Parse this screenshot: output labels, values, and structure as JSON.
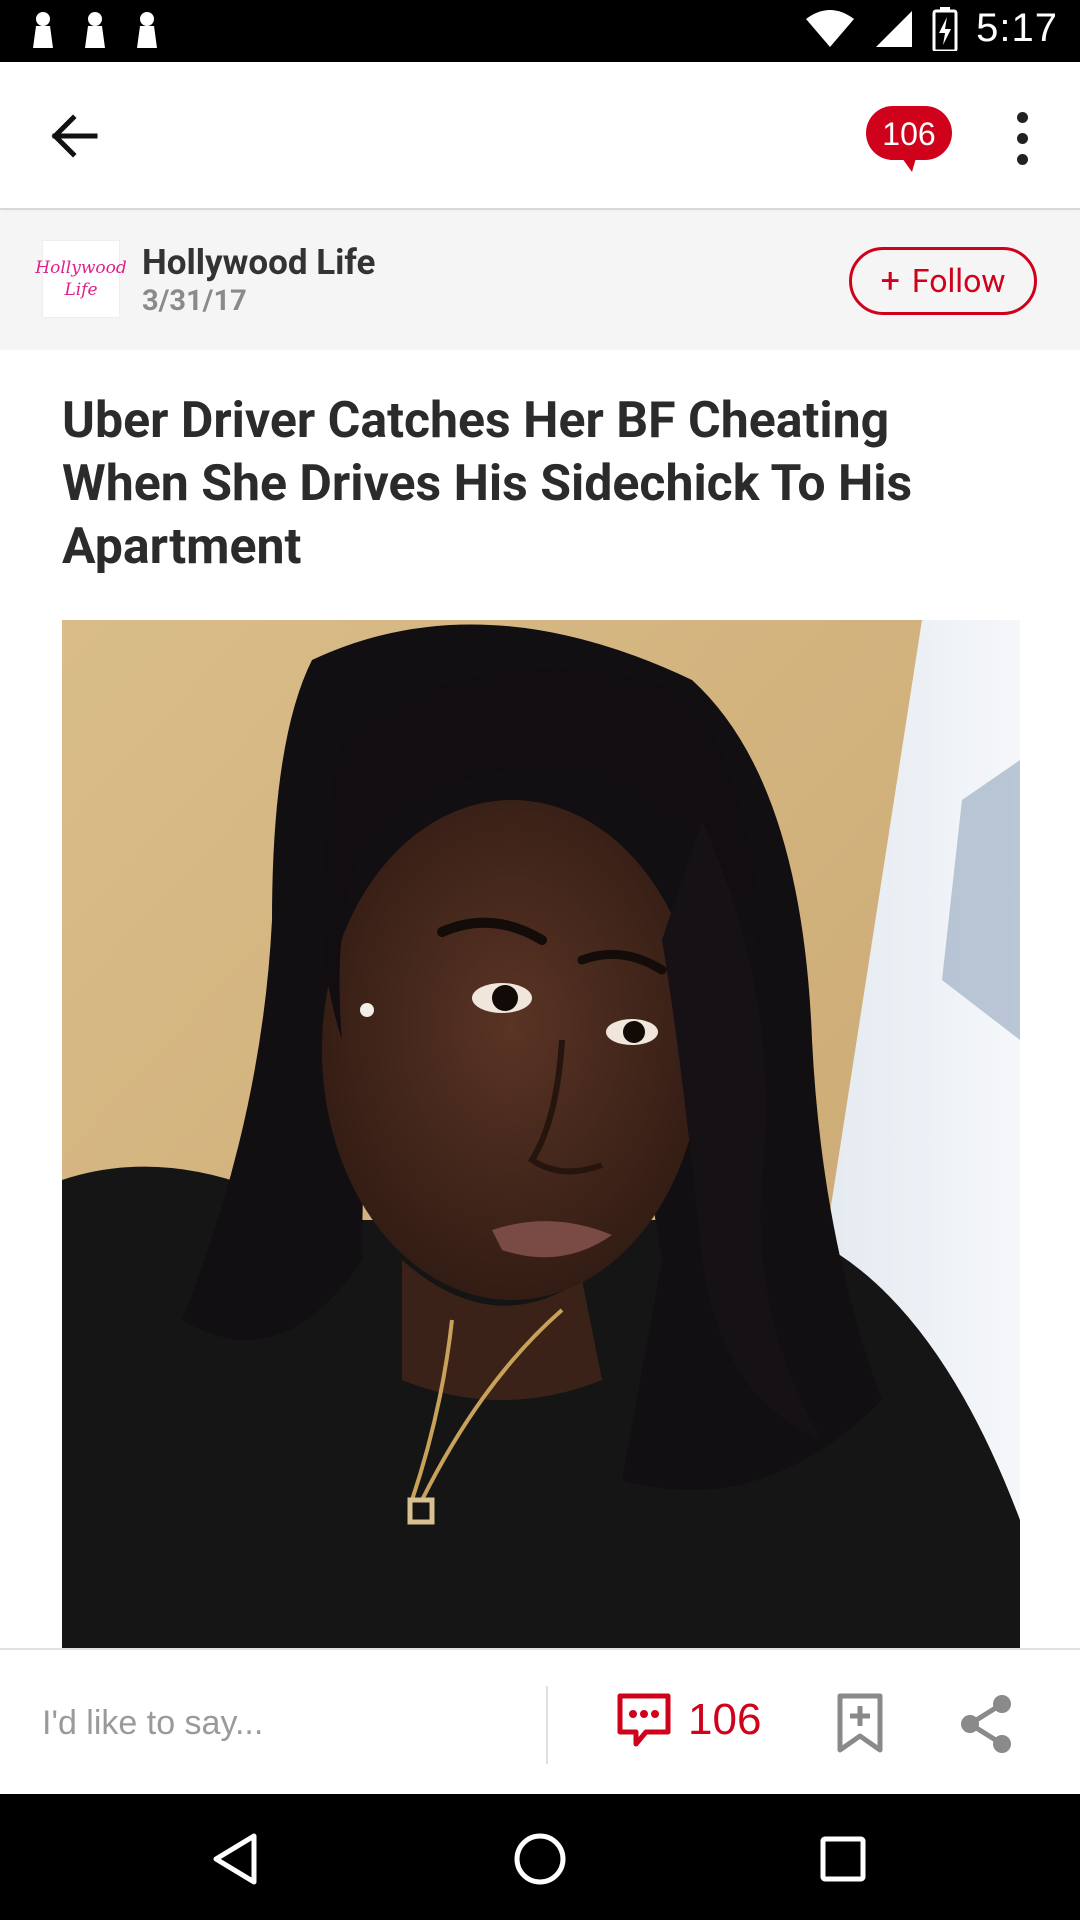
{
  "status_bar": {
    "time": "5:17",
    "icons": [
      "notification-icon",
      "notification-icon",
      "notification-icon",
      "wifi-icon",
      "cell-signal-icon",
      "battery-charging-icon"
    ]
  },
  "app_bar": {
    "back_icon": "arrow-left-icon",
    "comment_count": "106",
    "menu_icon": "more-vert-icon"
  },
  "publisher": {
    "logo_lines": [
      "Hollywood",
      "Life"
    ],
    "name": "Hollywood Life",
    "date": "3/31/17",
    "follow_plus": "+",
    "follow_label": "Follow"
  },
  "article": {
    "headline": "Uber Driver Catches Her BF Cheating When She Drives His Sidechick To His Apartment"
  },
  "action_bar": {
    "comment_placeholder": "I'd like to say...",
    "comment_count": "106",
    "accent_color": "#d0021b"
  },
  "nav_bar": {
    "icons": [
      "back-triangle-icon",
      "home-circle-icon",
      "recents-square-icon"
    ]
  }
}
